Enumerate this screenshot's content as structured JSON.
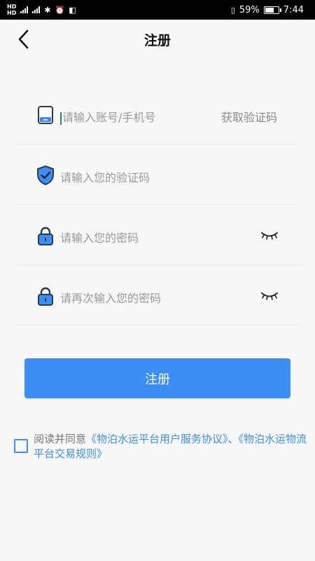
{
  "status_bar": {
    "battery_percent": "59%",
    "time": "7:44",
    "battery_level": 0.59
  },
  "header": {
    "title": "注册"
  },
  "form": {
    "account_placeholder": "请输入账号/手机号",
    "get_code_label": "获取验证码",
    "code_placeholder": "请输入您的验证码",
    "password_placeholder": "请输入您的密码",
    "confirm_password_placeholder": "请再次输入您的密码"
  },
  "submit_label": "注册",
  "agreement": {
    "prefix": "阅读并同意",
    "user_agreement_link": "《物泊水运平台用户服务协议》",
    "separator": "、",
    "trading_rules_link": "《物泊水运物流平台交易规则》"
  },
  "colors": {
    "accent": "#3d8ef2",
    "background": "#f7f7f7",
    "status_bar": "#000000"
  }
}
